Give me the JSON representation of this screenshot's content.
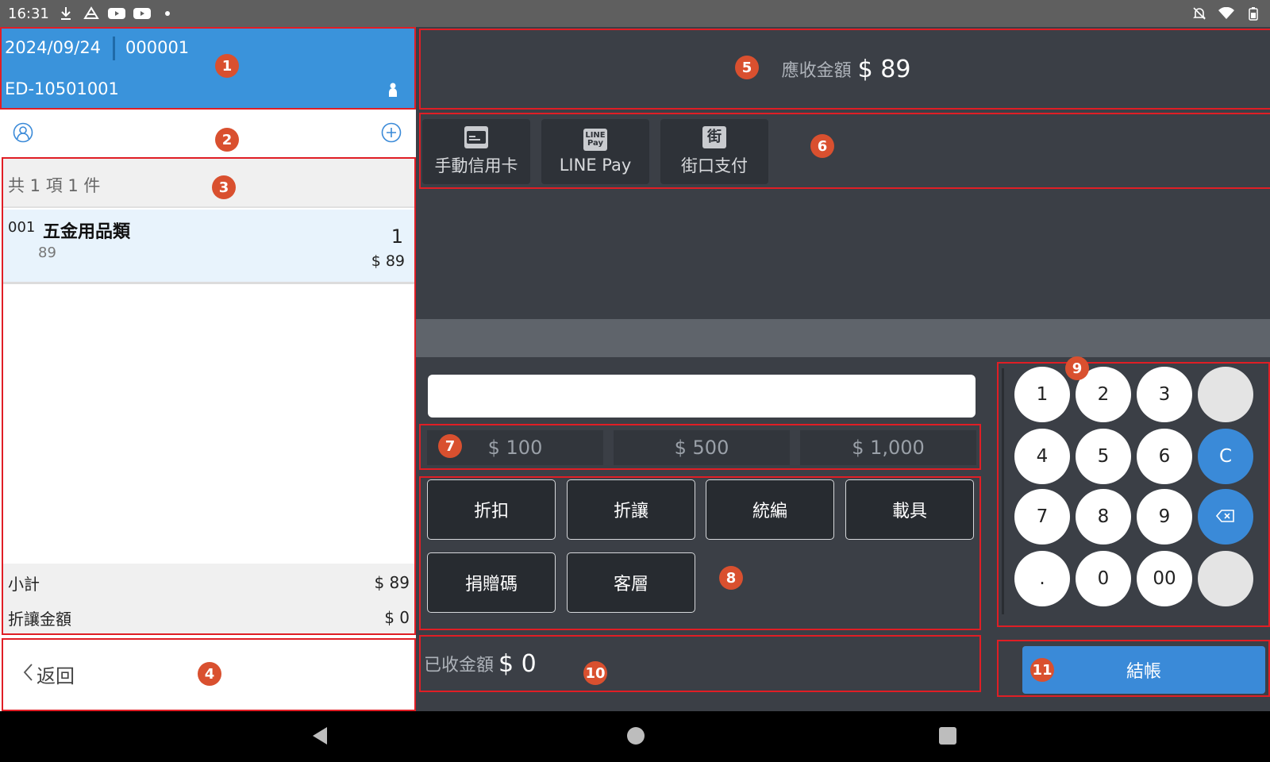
{
  "status_bar": {
    "time": "16:31"
  },
  "order": {
    "date": "2024/09/24",
    "number": "000001",
    "terminal_code": "ED-10501001"
  },
  "cart": {
    "summary": "共 1 項 1 件",
    "items": [
      {
        "no": "001",
        "name": "五金用品類",
        "unit_price": "89",
        "qty": "1",
        "total": "$ 89"
      }
    ],
    "subtotal_label": "小計",
    "subtotal_value": "$ 89",
    "discount_label": "折讓金額",
    "discount_value": "$ 0"
  },
  "back_label": "返回",
  "amount_due": {
    "label": "應收金額",
    "value": "$ 89"
  },
  "payment_methods": [
    {
      "label": "手動信用卡",
      "icon": "credit-card-icon"
    },
    {
      "label": "LINE Pay",
      "icon": "line-pay-icon",
      "icon_text_1": "LINE",
      "icon_text_2": "Pay"
    },
    {
      "label": "街口支付",
      "icon": "jkos-icon",
      "icon_text": "街"
    }
  ],
  "amount_input": {
    "value": "",
    "placeholder": ""
  },
  "quick_cash": [
    "$ 100",
    "$ 500",
    "$ 1,000"
  ],
  "functions": [
    "折扣",
    "折讓",
    "統編",
    "載具",
    "捐贈碼",
    "客層"
  ],
  "numpad": {
    "k1": "1",
    "k2": "2",
    "k3": "3",
    "k4": "4",
    "k5": "5",
    "k6": "6",
    "kc": "C",
    "k7": "7",
    "k8": "8",
    "k9": "9",
    "kdot": ".",
    "k0": "0",
    "k00": "00"
  },
  "received": {
    "label": "已收金額",
    "value": "$ 0"
  },
  "checkout_label": "結帳",
  "badges": [
    "1",
    "2",
    "3",
    "4",
    "5",
    "6",
    "7",
    "8",
    "9",
    "10",
    "11"
  ],
  "colors": {
    "header_blue": "#3a93db",
    "accent_blue": "#3a8ad8",
    "panel_dark": "#3b3f46",
    "badge_red": "#d9502f",
    "outline_red": "#e01e25"
  }
}
